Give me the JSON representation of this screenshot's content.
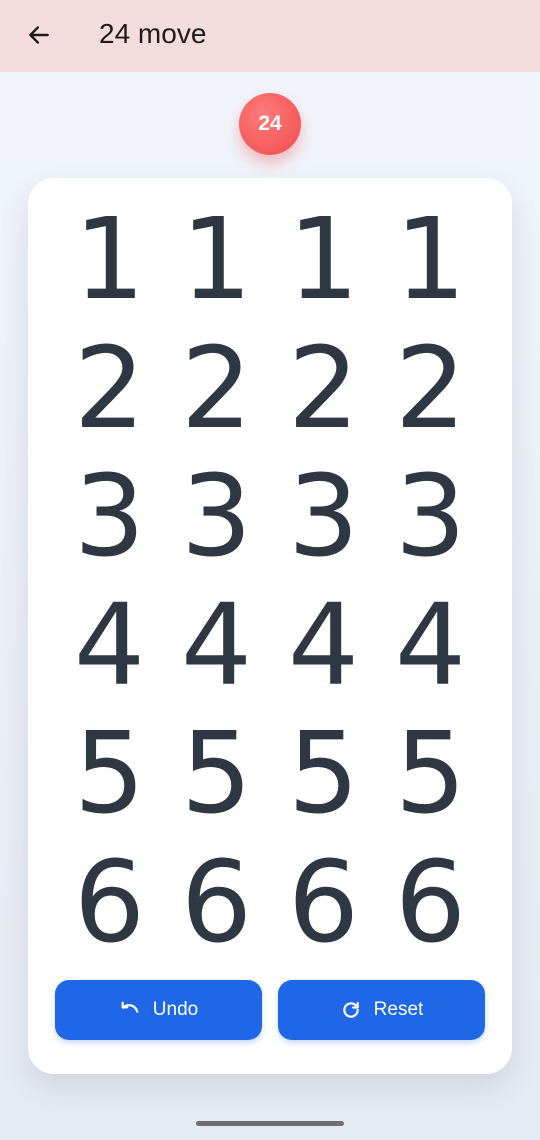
{
  "header": {
    "title": "24 move",
    "back_icon": "arrow-left-icon",
    "background": "#f3dcdc"
  },
  "move_badge": {
    "value": "24",
    "color": "#f45a5a"
  },
  "board": {
    "rows": [
      [
        "1",
        "1",
        "1",
        "1"
      ],
      [
        "2",
        "2",
        "2",
        "2"
      ],
      [
        "3",
        "3",
        "3",
        "3"
      ],
      [
        "4",
        "4",
        "4",
        "4"
      ],
      [
        "5",
        "5",
        "5",
        "5"
      ],
      [
        "6",
        "6",
        "6",
        "6"
      ]
    ]
  },
  "actions": {
    "undo_label": "Undo",
    "undo_icon": "undo-icon",
    "reset_label": "Reset",
    "reset_icon": "refresh-icon",
    "accent": "#1f67e6"
  }
}
